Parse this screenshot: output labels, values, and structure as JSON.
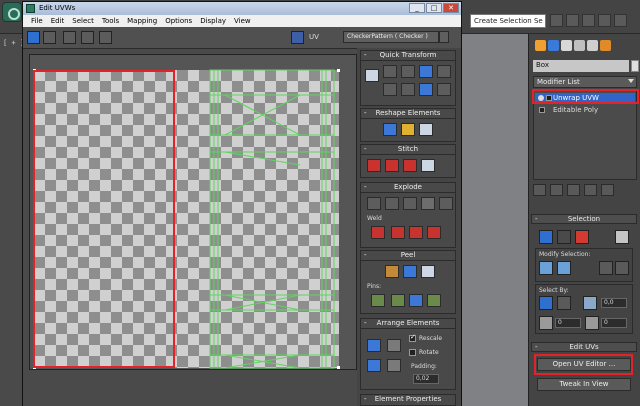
{
  "app": {
    "left_gutter_label": "[ + ] [ L",
    "selection_set_placeholder": "Create Selection Se"
  },
  "uvw_window": {
    "title": "Edit UVWs",
    "controls": [
      "_",
      "□",
      "✕"
    ],
    "menu": [
      "File",
      "Edit",
      "Select",
      "Tools",
      "Mapping",
      "Options",
      "Display",
      "View"
    ],
    "toolbar": {
      "uv_label": "UV",
      "texture_selected": "CheckerPattern  ( Checker )"
    },
    "panel": {
      "quick_transform": "Quick Transform",
      "reshape_elements": "Reshape Elements",
      "stitch": "Stitch",
      "explode": "Explode",
      "weld_label": "Weld",
      "peel": "Peel",
      "pins_label": "Pins:",
      "arrange_elements": "Arrange Elements",
      "rescale_label": "Rescale",
      "rescale_checked": true,
      "rotate_label": "Rotate",
      "rotate_checked": false,
      "padding_label": "Padding:",
      "padding_value": "0,02",
      "element_properties": "Element Properties"
    }
  },
  "command_panel": {
    "object_name": "Box",
    "modifier_list_label": "Modifier List",
    "stack": [
      {
        "label": "Unwrap UVW",
        "active": true
      },
      {
        "label": "Editable Poly",
        "active": false
      }
    ],
    "selection_title": "Selection",
    "modify_selection_label": "Modify Selection:",
    "select_by_label": "Select By:",
    "select_by_value": "0,0",
    "loop_value_a": "0",
    "loop_value_b": "0",
    "edit_uvs_title": "Edit UVs",
    "open_uv_editor_label": "Open UV Editor ...",
    "tweak_in_view_label": "Tweak In View"
  },
  "colors": {
    "highlight_red": "#e3222a",
    "selection_blue": "#3264c8",
    "uv_edge_green": "#5fd45f"
  }
}
